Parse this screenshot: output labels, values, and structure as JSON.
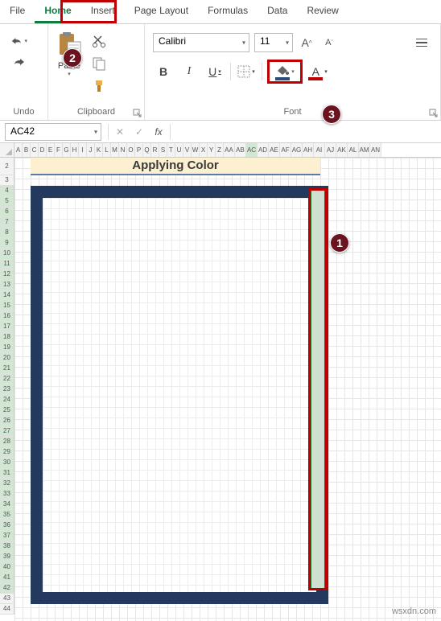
{
  "tabs": [
    "File",
    "Home",
    "Insert",
    "Page Layout",
    "Formulas",
    "Data",
    "Review"
  ],
  "active_tab": "Home",
  "ribbon": {
    "undo": {
      "label": "Undo"
    },
    "clipboard": {
      "paste_label": "Paste",
      "label": "Clipboard"
    },
    "font": {
      "label": "Font",
      "name": "Calibri",
      "size": "11",
      "bold": "B",
      "italic": "I",
      "underline": "U"
    }
  },
  "namebox": "AC42",
  "fx_label": "fx",
  "sheet": {
    "title": "Applying Color",
    "columns": [
      "A",
      "B",
      "C",
      "D",
      "E",
      "F",
      "G",
      "H",
      "I",
      "J",
      "K",
      "L",
      "M",
      "N",
      "O",
      "P",
      "Q",
      "R",
      "S",
      "T",
      "U",
      "V",
      "W",
      "X",
      "Y",
      "Z",
      "AA",
      "AB",
      "AC",
      "AD",
      "AE",
      "AF",
      "AG",
      "AH",
      "AI",
      "AJ",
      "AK",
      "AL",
      "AM",
      "AN"
    ],
    "rows_start": 2,
    "rows_end": 44,
    "selected_column": "AC",
    "selected_rows": [
      4,
      5,
      6,
      7,
      8,
      9,
      10,
      11,
      12,
      13,
      14,
      15,
      16,
      17,
      18,
      19,
      20,
      21,
      22,
      23,
      24,
      25,
      26,
      27,
      28,
      29,
      30,
      31,
      32,
      33,
      34,
      35,
      36,
      37,
      38,
      39,
      40,
      41,
      42
    ]
  },
  "callouts": {
    "c1": "1",
    "c2": "2",
    "c3": "3"
  },
  "watermark": "wsxdn.com"
}
